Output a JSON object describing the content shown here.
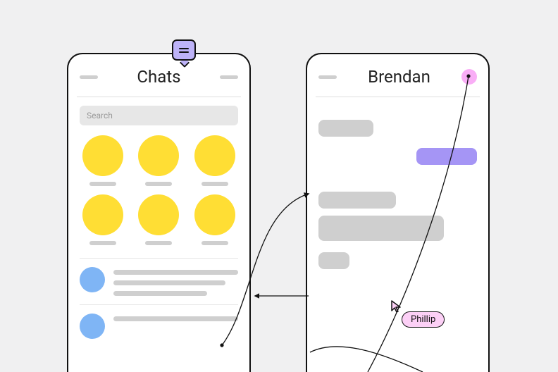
{
  "left_screen": {
    "title": "Chats",
    "search_placeholder": "Search"
  },
  "right_screen": {
    "title": "Brendan"
  },
  "collaborator_tag": "Phillip"
}
